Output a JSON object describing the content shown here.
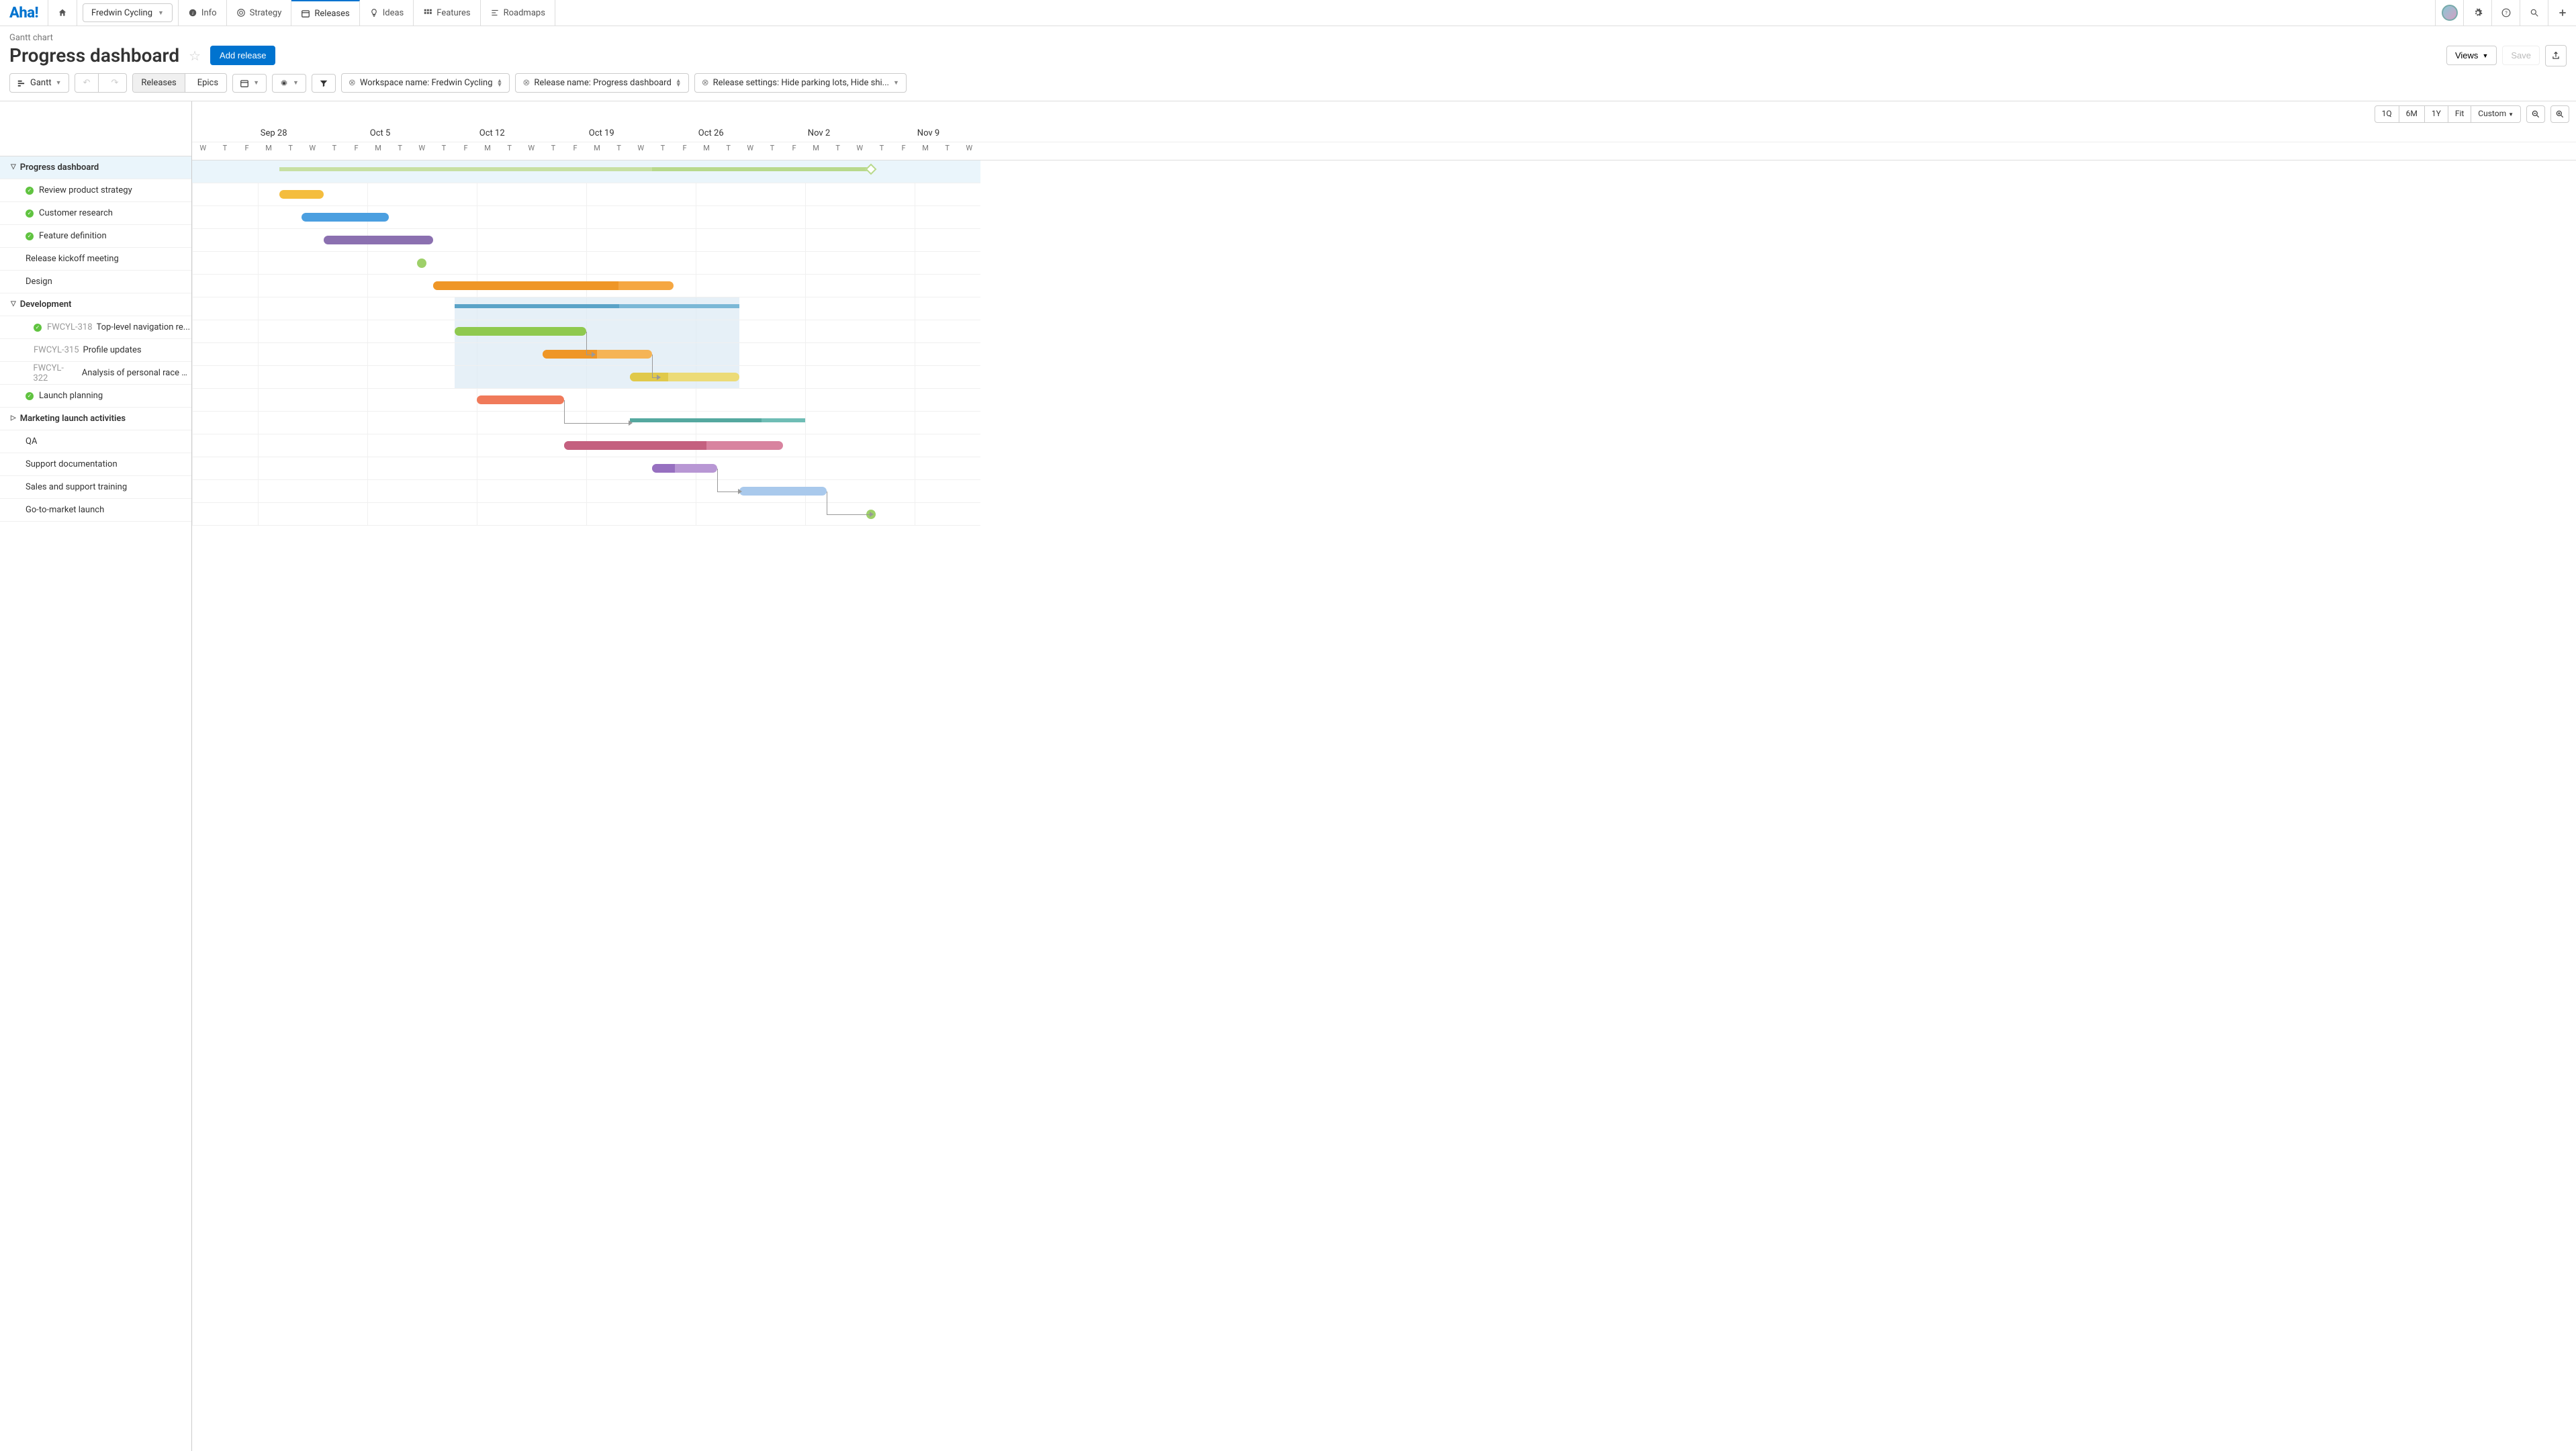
{
  "app": {
    "logo": "Aha!"
  },
  "topnav": {
    "workspace": "Fredwin Cycling",
    "items": [
      {
        "label": "Info",
        "icon": "info"
      },
      {
        "label": "Strategy",
        "icon": "target"
      },
      {
        "label": "Releases",
        "icon": "calendar",
        "active": true
      },
      {
        "label": "Ideas",
        "icon": "bulb"
      },
      {
        "label": "Features",
        "icon": "grid"
      },
      {
        "label": "Roadmaps",
        "icon": "roadmap"
      }
    ]
  },
  "page": {
    "breadcrumb": "Gantt chart",
    "title": "Progress dashboard",
    "add_release": "Add release",
    "views": "Views",
    "save": "Save"
  },
  "toolbar": {
    "gantt": "Gantt",
    "releases": "Releases",
    "epics": "Epics",
    "workspace_filter": "Workspace name: Fredwin Cycling",
    "release_filter": "Release name: Progress dashboard",
    "release_settings": "Release settings: Hide parking lots, Hide shi..."
  },
  "zoom": {
    "q": "1Q",
    "m6": "6M",
    "y": "1Y",
    "fit": "Fit",
    "custom": "Custom"
  },
  "timeline": {
    "start_day_index": 0,
    "day_width": 32.6,
    "weeks": [
      {
        "label": "",
        "day": 0
      },
      {
        "label": "Sep 28",
        "day": 3
      },
      {
        "label": "Oct 5",
        "day": 8
      },
      {
        "label": "Oct 12",
        "day": 13
      },
      {
        "label": "Oct 19",
        "day": 18
      },
      {
        "label": "Oct 26",
        "day": 23
      },
      {
        "label": "Nov 2",
        "day": 28
      },
      {
        "label": "Nov 9",
        "day": 33
      }
    ],
    "days": [
      "W",
      "T",
      "F",
      "M",
      "T",
      "W",
      "T",
      "F",
      "M",
      "T",
      "W",
      "T",
      "F",
      "M",
      "T",
      "W",
      "T",
      "F",
      "M",
      "T",
      "W",
      "T",
      "F",
      "M",
      "T",
      "W",
      "T",
      "F",
      "M",
      "T",
      "W",
      "T",
      "F",
      "M",
      "T",
      "W"
    ]
  },
  "tasks": [
    {
      "id": "progress",
      "label": "Progress dashboard",
      "level": 1,
      "expanded": true,
      "hl": true,
      "bar": {
        "type": "summary",
        "start": 4,
        "end": 31,
        "color": "#b8d98c",
        "done_end": 21,
        "done_color": "#c7e0a3",
        "diamond": 31
      }
    },
    {
      "id": "review",
      "label": "Review product strategy",
      "level": 2,
      "status": "done",
      "bar": {
        "start": 4,
        "end": 6,
        "color": "#f4bd3e",
        "done": 1.0
      }
    },
    {
      "id": "custres",
      "label": "Customer research",
      "level": 2,
      "status": "done",
      "bar": {
        "start": 5,
        "end": 9,
        "color": "#4b9fe0",
        "done": 1.0
      }
    },
    {
      "id": "featdef",
      "label": "Feature definition",
      "level": 2,
      "status": "done",
      "bar": {
        "start": 6,
        "end": 11,
        "color": "#8b70b0",
        "done": 1.0
      }
    },
    {
      "id": "kickoff",
      "label": "Release kickoff meeting",
      "level": 2,
      "bar": {
        "type": "milestone",
        "start": 10.5,
        "color": "#9ed069"
      }
    },
    {
      "id": "design",
      "label": "Design",
      "level": 2,
      "bar": {
        "start": 11,
        "end": 22,
        "color": "#f5a742",
        "done": 0.77,
        "done_color": "#ef9626"
      }
    },
    {
      "id": "dev",
      "label": "Development",
      "level": 1,
      "expanded": true,
      "bar": {
        "type": "summary",
        "start": 12,
        "end": 25,
        "color": "#7bb8d6",
        "done_end": 19.5,
        "done_color": "#5aa3c7"
      },
      "bg": {
        "start": 12,
        "end": 25,
        "rows": 4
      }
    },
    {
      "id": "318",
      "task_id": "FWCYL-318",
      "label": "Top-level navigation re...",
      "level": 3,
      "status": "done",
      "bar": {
        "start": 12,
        "end": 18,
        "color": "#8fc94f",
        "done": 1.0
      }
    },
    {
      "id": "315",
      "task_id": "FWCYL-315",
      "label": "Profile updates",
      "level": 3,
      "bar": {
        "start": 16,
        "end": 21,
        "color": "#f5b456",
        "done": 0.5,
        "done_color": "#ef9626"
      }
    },
    {
      "id": "322",
      "task_id": "FWCYL-322",
      "label": "Analysis of personal race g...",
      "level": 3,
      "bar": {
        "start": 20,
        "end": 25,
        "color": "#ecdb77",
        "done": 0.35,
        "done_color": "#e0c94a"
      }
    },
    {
      "id": "launch",
      "label": "Launch planning",
      "level": 2,
      "status": "done",
      "bar": {
        "start": 13,
        "end": 17,
        "color": "#f07a5a",
        "done": 1.0
      }
    },
    {
      "id": "mktg",
      "label": "Marketing launch activities",
      "level": 1,
      "expanded": false,
      "bar": {
        "type": "summary",
        "start": 20,
        "end": 28,
        "color": "#6fbdb5",
        "done_end": 26,
        "done_color": "#55a89f"
      }
    },
    {
      "id": "qa",
      "label": "QA",
      "level": 2,
      "bar": {
        "start": 17,
        "end": 27,
        "color": "#d8839f",
        "done": 0.65,
        "done_color": "#c4607f"
      }
    },
    {
      "id": "support",
      "label": "Support documentation",
      "level": 2,
      "bar": {
        "start": 21,
        "end": 24,
        "color": "#b897d4",
        "done": 0.35,
        "done_color": "#9770c0"
      }
    },
    {
      "id": "training",
      "label": "Sales and support training",
      "level": 2,
      "bar": {
        "start": 25,
        "end": 29,
        "color": "#a9c9ec",
        "done": 0.0,
        "done_color": "#7fb0e0"
      }
    },
    {
      "id": "gotomarket",
      "label": "Go-to-market launch",
      "level": 2,
      "bar": {
        "type": "milestone",
        "start": 31,
        "color": "#9ed069"
      }
    }
  ],
  "dependencies": [
    {
      "from_row": 7,
      "from_day": 18,
      "to_row": 8,
      "to_day": 18.3
    },
    {
      "from_row": 8,
      "from_day": 21,
      "to_row": 9,
      "to_day": 21.3
    },
    {
      "from_row": 10,
      "from_day": 17,
      "to_row": 11,
      "to_day": 20
    },
    {
      "from_row": 13,
      "from_day": 24,
      "to_row": 14,
      "to_day": 25
    },
    {
      "from_row": 14,
      "from_day": 29,
      "to_row": 15,
      "to_day": 31
    }
  ]
}
